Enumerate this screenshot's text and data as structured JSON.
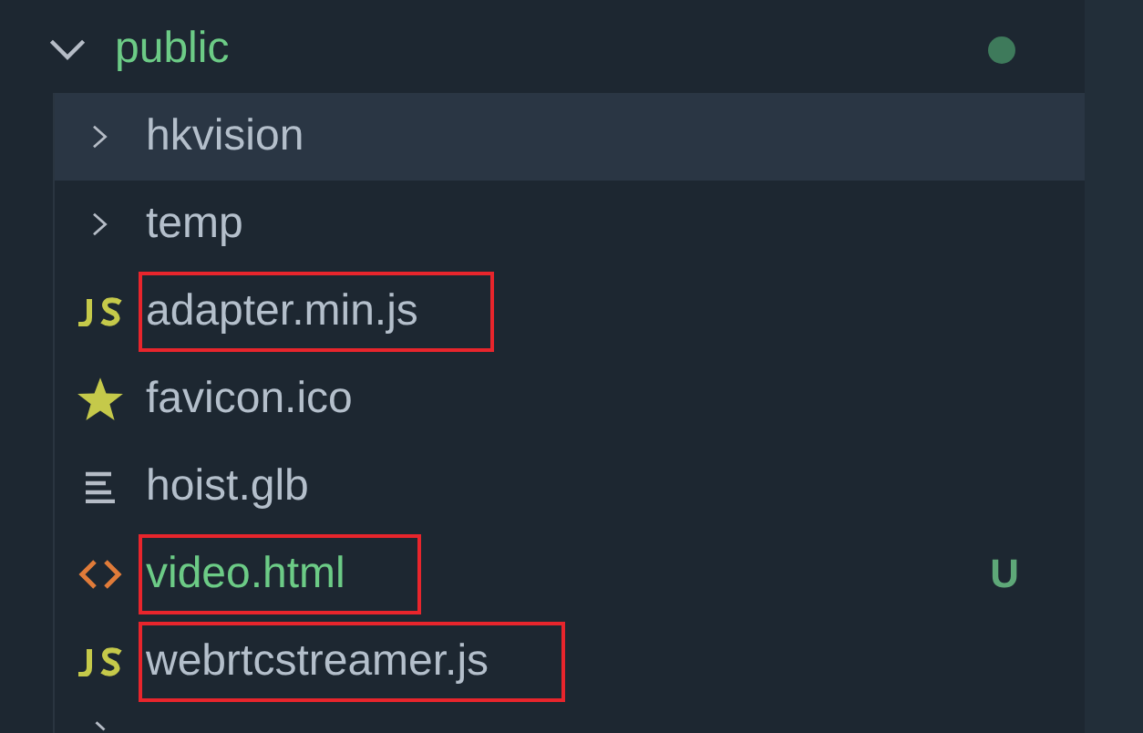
{
  "folder": {
    "name": "public",
    "expanded": true,
    "modified": true,
    "children": [
      {
        "kind": "folder",
        "name": "hkvision",
        "expanded": false,
        "selected": true,
        "highlighted": false,
        "untracked": false
      },
      {
        "kind": "folder",
        "name": "temp",
        "expanded": false,
        "selected": false,
        "highlighted": false,
        "untracked": false
      },
      {
        "kind": "js",
        "name": "adapter.min.js",
        "selected": false,
        "highlighted": true,
        "untracked": false
      },
      {
        "kind": "favicon",
        "name": "favicon.ico",
        "selected": false,
        "highlighted": false,
        "untracked": false
      },
      {
        "kind": "text",
        "name": "hoist.glb",
        "selected": false,
        "highlighted": false,
        "untracked": false
      },
      {
        "kind": "html",
        "name": "video.html",
        "selected": false,
        "highlighted": true,
        "untracked": true,
        "badge": "U"
      },
      {
        "kind": "js",
        "name": "webrtcstreamer.js",
        "selected": false,
        "highlighted": true,
        "untracked": false
      }
    ]
  }
}
